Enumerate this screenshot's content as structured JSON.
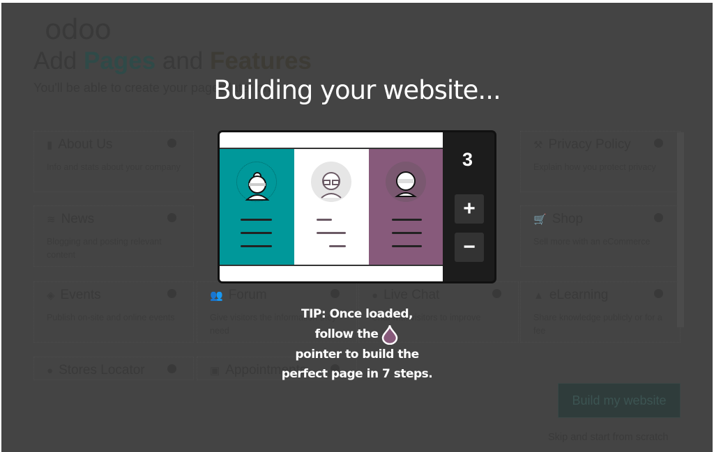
{
  "background": {
    "logo": "odoo",
    "heading_1": "Add ",
    "heading_pages": "Pages",
    "heading_2": " and ",
    "heading_features": "Features",
    "subtitle": "You'll be able to create your pages later on.",
    "cards": [
      {
        "title": "About Us",
        "desc": "Info and stats about your company",
        "icon": "building-icon"
      },
      {
        "title": "Privacy Policy",
        "desc": "Explain how you protect privacy",
        "icon": "gavel-icon"
      },
      {
        "title": "News",
        "desc": "Blogging and posting relevant content",
        "icon": "rss-icon"
      },
      {
        "title": "Shop",
        "desc": "Sell more with an eCommerce",
        "icon": "cart-icon"
      },
      {
        "title": "Events",
        "desc": "Publish on-site and online events",
        "icon": "ticket-icon"
      },
      {
        "title": "Forum",
        "desc": "Give visitors the information they need",
        "icon": "users-icon"
      },
      {
        "title": "Live Chat",
        "desc": "Chat with visitors to improve",
        "icon": "chat-icon"
      },
      {
        "title": "eLearning",
        "desc": "Share knowledge publicly or for a fee",
        "icon": "graduation-cap-icon"
      },
      {
        "title": "Stores Locator",
        "desc": "",
        "icon": "map-marker-icon"
      },
      {
        "title": "Appointments",
        "desc": "",
        "icon": "id-card-icon"
      }
    ],
    "build_button": "Build my website",
    "skip_link": "Skip and start from scratch"
  },
  "overlay": {
    "title": "Building your website...",
    "step": "3",
    "plus": "+",
    "minus": "−",
    "tip_1": "TIP: Once loaded,",
    "tip_2": "follow the",
    "tip_3": "pointer to build the",
    "tip_4": "perfect page in 7 steps.",
    "colors": {
      "teal": "#00989a",
      "purple": "#875a7b"
    }
  }
}
